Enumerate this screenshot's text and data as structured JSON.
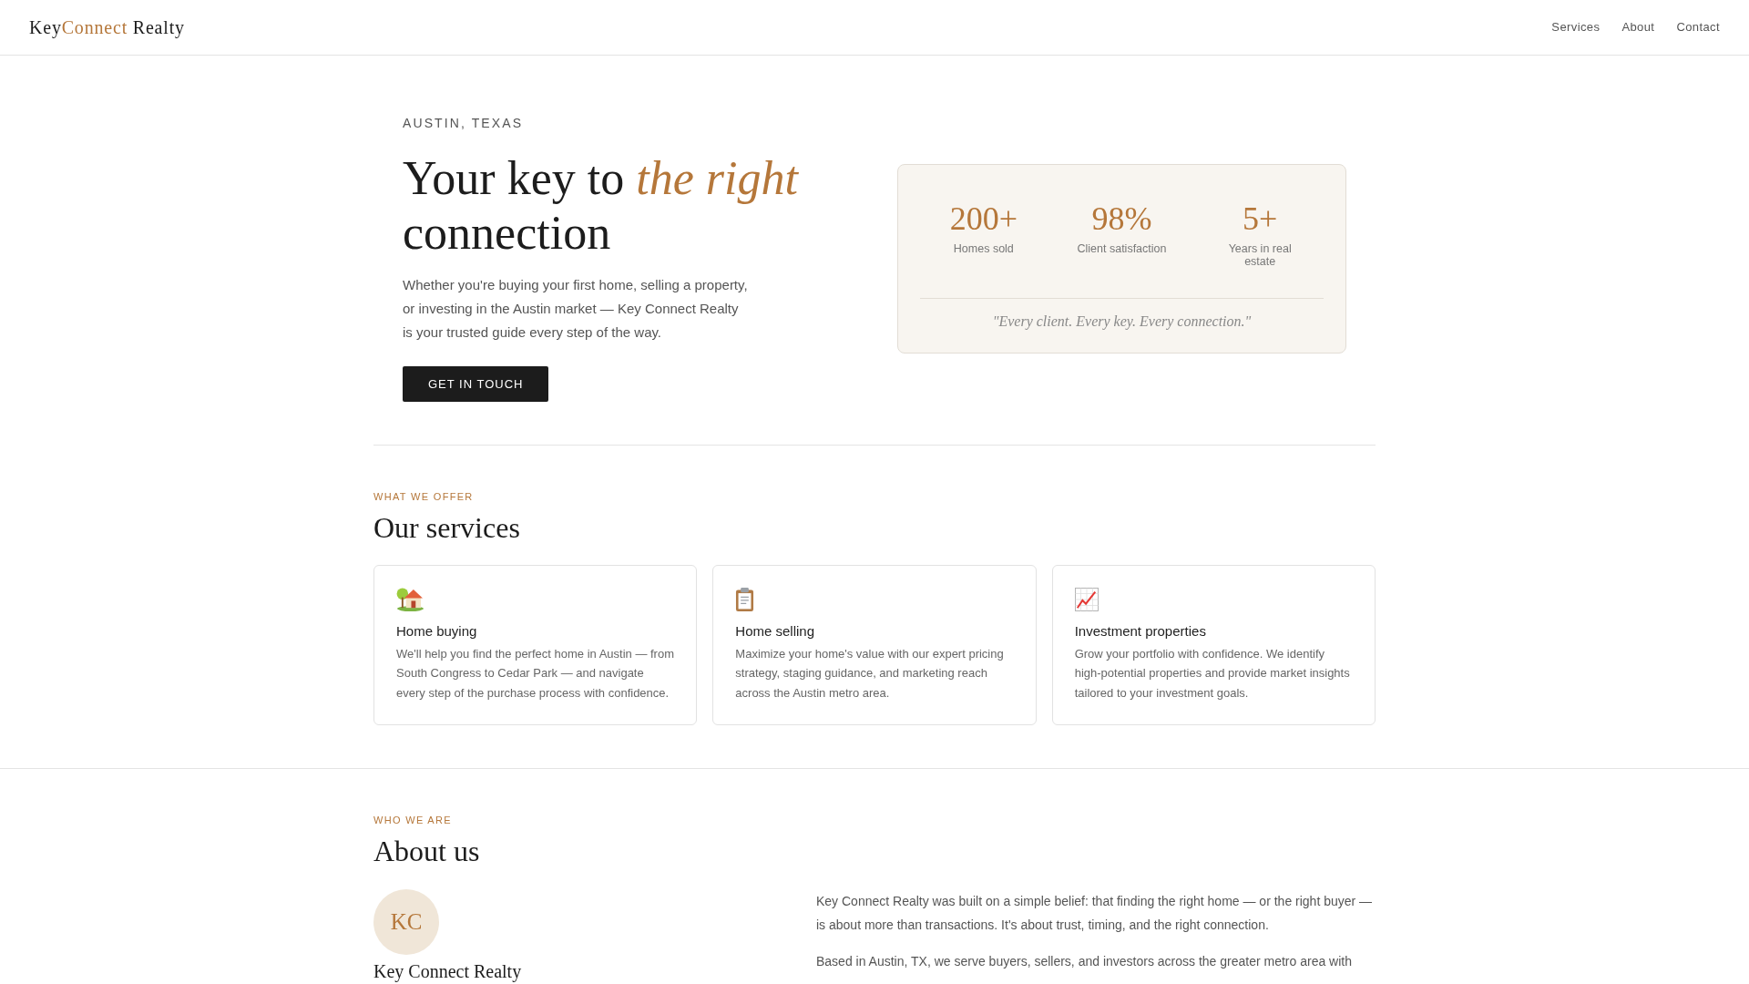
{
  "header": {
    "logo": [
      {
        "text": "Key",
        "color": "#1c1c1c"
      },
      {
        "text": "Connect",
        "color": "#b5773a"
      },
      {
        "text": " Realty",
        "color": "#1c1c1c"
      }
    ],
    "nav": [
      "Services",
      "About",
      "Contact"
    ]
  },
  "hero": {
    "eyebrow": "AUSTIN, TEXAS",
    "headline": "Your key to *the right* connection",
    "intro": "Whether you're buying your first home, selling a property, or investing in the Austin market — Key Connect Realty is your trusted guide every step of the way.",
    "button": "GET IN TOUCH",
    "stats": [
      {
        "value": "200+",
        "label": "Homes sold"
      },
      {
        "value": "98%",
        "label": "Client satisfaction"
      },
      {
        "value": "5+",
        "label": "Years in real estate"
      }
    ],
    "quote": "\"Every client. Every key. Every connection.\""
  },
  "services": {
    "eyebrow": "WHAT WE OFFER",
    "title": "Our services",
    "cards": [
      {
        "kind": "buying",
        "title": "Home buying",
        "text": "We'll help you find the perfect home in Austin — from South Congress to Cedar Park — and navigate every step of the purchase process with confidence."
      },
      {
        "kind": "selling",
        "title": "Home selling",
        "text": "Maximize your home's value with our expert pricing strategy, staging guidance, and marketing reach across the Austin metro area."
      },
      {
        "kind": "investing",
        "title": "Investment properties",
        "text": "Grow your portfolio with confidence. We identify high-potential properties and provide market insights tailored to your investment goals."
      }
    ]
  },
  "about": {
    "eyebrow": "WHO WE ARE",
    "title": "About us",
    "monogram": "KC",
    "name": "Key Connect Realty",
    "paragraphs": [
      "Key Connect Realty was built on a simple belief: that finding the right home — or the right buyer — is about more than transactions. It's about trust, timing, and the right connection.",
      "Based in Austin, TX, we serve buyers, sellers, and investors across the greater metro area with"
    ]
  }
}
